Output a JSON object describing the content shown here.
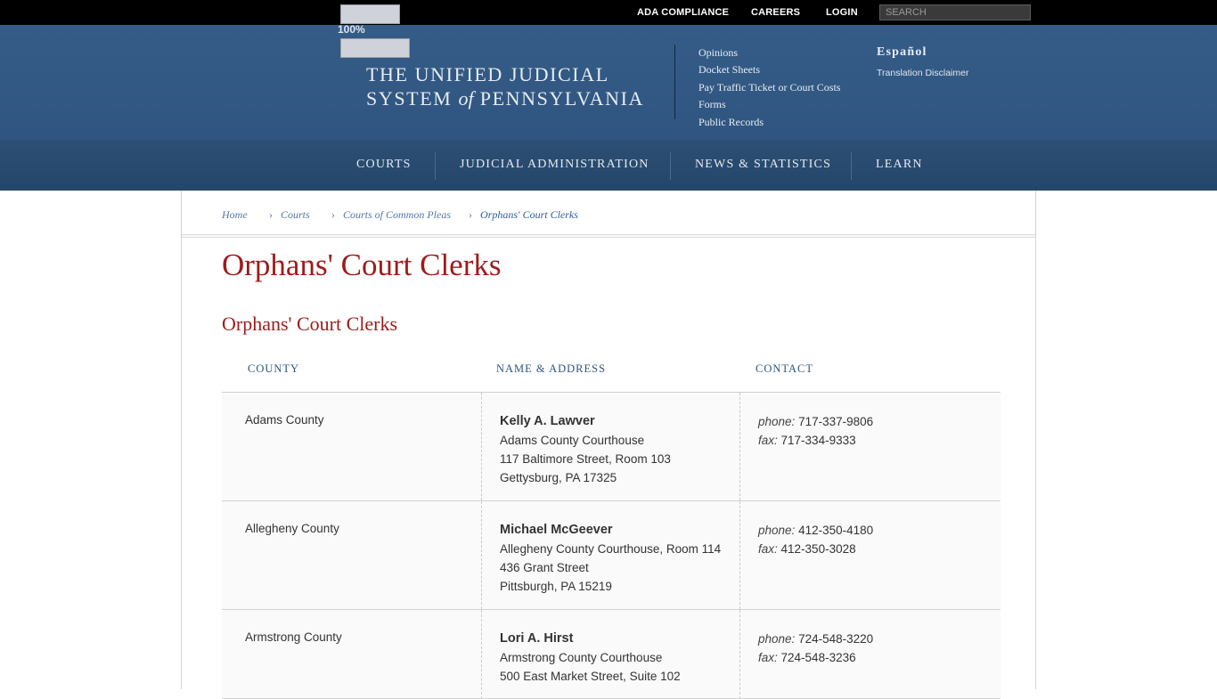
{
  "topbar": {
    "zoom": "100%",
    "links": [
      "ADA COMPLIANCE",
      "CAREERS",
      "LOGIN"
    ],
    "search_placeholder": "SEARCH"
  },
  "header": {
    "logo_line1": "THE UNIFIED JUDICIAL",
    "logo_line2_a": "SYSTEM",
    "logo_line2_of": "of",
    "logo_line2_b": "PENNSYLVANIA",
    "quick_links": [
      "Opinions",
      "Docket Sheets",
      "Pay Traffic Ticket or Court Costs",
      "Forms",
      "Public Records"
    ],
    "language": "Español",
    "disclaimer": "Translation Disclaimer"
  },
  "nav": [
    "COURTS",
    "JUDICIAL ADMINISTRATION",
    "NEWS & STATISTICS",
    "LEARN"
  ],
  "breadcrumbs": [
    "Home",
    "Courts",
    "Courts of Common Pleas",
    "Orphans' Court Clerks"
  ],
  "page_title": "Orphans' Court Clerks",
  "section_title": "Orphans' Court Clerks",
  "table": {
    "headers": [
      "COUNTY",
      "NAME & ADDRESS",
      "CONTACT"
    ],
    "phone_label": "phone:",
    "fax_label": "fax:",
    "rows": [
      {
        "county": "Adams County",
        "name": "Kelly A. Lawver",
        "address": [
          "Adams County Courthouse",
          "117 Baltimore Street, Room 103",
          "Gettysburg, PA 17325"
        ],
        "phone": "717-337-9806",
        "fax": "717-334-9333"
      },
      {
        "county": "Allegheny County",
        "name": "Michael McGeever",
        "address": [
          "Allegheny County Courthouse, Room 114",
          "436 Grant Street",
          "Pittsburgh, PA 15219"
        ],
        "phone": "412-350-4180",
        "fax": "412-350-3028"
      },
      {
        "county": "Armstrong County",
        "name": "Lori A. Hirst",
        "address": [
          "Armstrong County Courthouse",
          "500 East Market Street, Suite 102",
          ""
        ],
        "phone": "724-548-3220",
        "fax": "724-548-3236"
      }
    ]
  }
}
